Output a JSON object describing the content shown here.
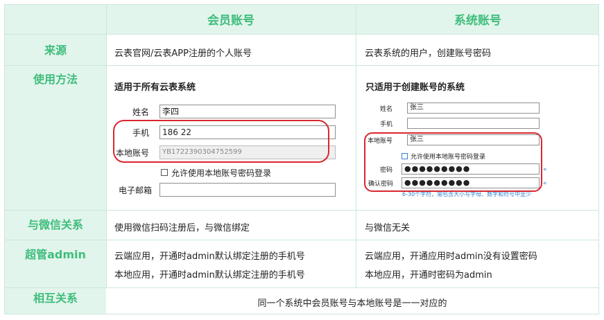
{
  "header": {
    "member": "会员账号",
    "system": "系统账号"
  },
  "rows": {
    "source": {
      "label": "来源",
      "member": "云表官网/云表APP注册的个人账号",
      "system": "云表系统的用户，创建账号密码"
    },
    "usage": {
      "label": "使用方法",
      "member": {
        "title": "适用于所有云表系统",
        "name_label": "姓名",
        "name_value": "李四",
        "phone_label": "手机",
        "phone_value": "186    22",
        "local_label": "本地账号",
        "local_value": "YB1722390304752599",
        "allow_label": "允许使用本地账号密码登录",
        "email_label": "电子邮箱",
        "email_value": ""
      },
      "system": {
        "title": "只适用于创建账号的系统",
        "name_label": "姓名",
        "name_value": "张三",
        "phone_label": "手机",
        "phone_value": "",
        "local_label": "本地账号",
        "local_value": "张三",
        "allow_label": "允许使用本地账号密码登录",
        "pwd_label": "密码",
        "pwd_value": "●●●●●●●●●",
        "confirm_label": "确认密码",
        "confirm_value": "●●●●●●●●●",
        "hint": "6-30个字符，需包含大小写字母、数字和符号中至少"
      }
    },
    "wechat": {
      "label": "与微信关系",
      "member": "使用微信扫码注册后，与微信绑定",
      "system": "与微信无关"
    },
    "admin": {
      "label": "超管admin",
      "member_1": "云端应用，开通时admin默认绑定注册的手机号",
      "member_2": "本地应用，开通时admin默认绑定注册的手机号",
      "system_1": "云端应用，开通应用时admin没有设置密码",
      "system_2": "本地应用，开通时密码为admin"
    },
    "relation": {
      "label": "相互关系",
      "text": "同一个系统中会员账号与本地账号是一一对应的"
    }
  },
  "colors": {
    "accent": "#3fbd7c",
    "header_bg": "#e2f5ec",
    "highlight": "#d9262e",
    "hint": "#2f7fd1"
  }
}
